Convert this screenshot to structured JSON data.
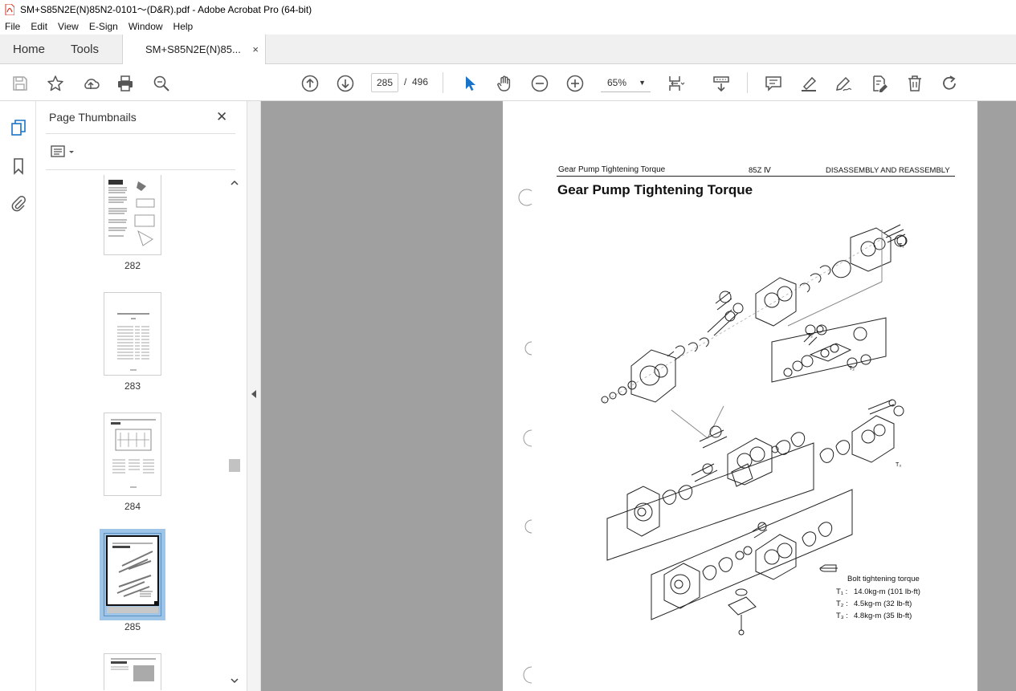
{
  "window": {
    "title": "SM+S85N2E(N)85N2-0101～(D&R).pdf - Adobe Acrobat Pro (64-bit)"
  },
  "menu": [
    "File",
    "Edit",
    "View",
    "E-Sign",
    "Window",
    "Help"
  ],
  "tabs": {
    "home": "Home",
    "tools": "Tools",
    "document": "SM+S85N2E(N)85...",
    "close": "×"
  },
  "toolbar": {
    "current_page": "285",
    "separator": "/",
    "total_pages": "496",
    "zoom": "65%",
    "icons": [
      "save-icon",
      "bookmark-star-icon",
      "share-icon",
      "print-icon",
      "search-icon",
      "previous-page-icon",
      "next-page-icon",
      "select-cursor-icon",
      "hand-icon",
      "zoom-out-icon",
      "zoom-in-icon",
      "page-fit-icon",
      "scroll-mode-icon",
      "comment-icon",
      "highlight-icon",
      "sign-icon",
      "edit-pdf-icon",
      "delete-icon",
      "redo-icon"
    ]
  },
  "thumbnails": {
    "title": "Page Thumbnails",
    "close": "✕",
    "pages": [
      {
        "label": "282",
        "selected": false
      },
      {
        "label": "283",
        "selected": false
      },
      {
        "label": "284",
        "selected": false
      },
      {
        "label": "285",
        "selected": true
      }
    ]
  },
  "document": {
    "header_left": "Gear Pump Tightening Torque",
    "header_mid": "85Z Ⅳ",
    "header_right": "DISASSEMBLY AND REASSEMBLY",
    "title": "Gear Pump Tightening Torque",
    "legend": {
      "title": "Bolt tightening torque",
      "t1_label": "T₁ :",
      "t1_value": "14.0kg-m (101 lb-ft)",
      "t2_label": "T₂ :",
      "t2_value": "4.5kg-m (32 lb-ft)",
      "t3_label": "T₃ :",
      "t3_value": "4.8kg-m (35 lb-ft)"
    },
    "callouts": [
      "T₁",
      "T₂",
      "T₂",
      "T₃"
    ]
  },
  "colors": {
    "accent_blue": "#1a73c7",
    "doc_background": "#a0a0a0",
    "selection": "#9ec5e8"
  }
}
